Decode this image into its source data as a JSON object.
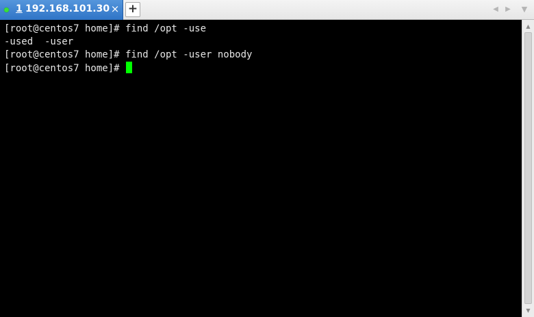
{
  "tabs": [
    {
      "number": "1",
      "title": "192.168.101.30",
      "status_color": "#38e038",
      "close_glyph": "×"
    }
  ],
  "tabbar": {
    "new_tab_glyph": "+",
    "nav_left_glyph": "◀",
    "nav_right_glyph": "▶",
    "menu_glyph": "▼"
  },
  "terminal": {
    "lines": [
      "[root@centos7 home]# find /opt -use",
      "-used  -user",
      "[root@centos7 home]# find /opt -user nobody",
      "[root@centos7 home]#"
    ],
    "cursor_color": "#00ff00",
    "background": "#000000",
    "foreground": "#e6e6e6"
  },
  "scrollbar": {
    "up_glyph": "▲",
    "down_glyph": "▼"
  },
  "colors": {
    "tab_active": "#2f74c6",
    "tabbar_background": "#ececec"
  }
}
